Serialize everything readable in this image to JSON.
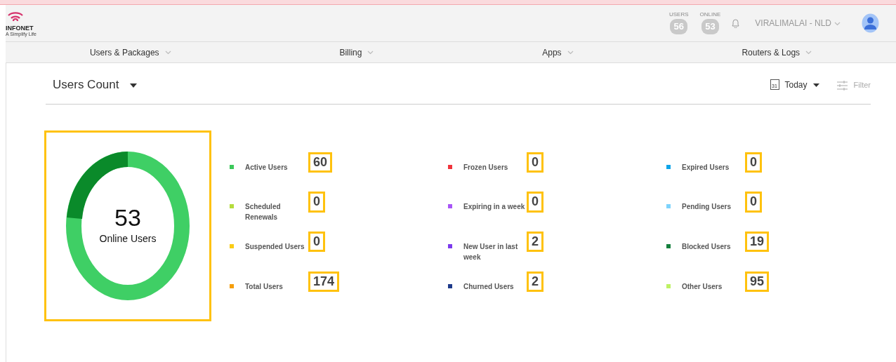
{
  "header": {
    "logo_text": "INFONET",
    "tagline": "A Simplify Life",
    "counters": [
      {
        "label": "USERS",
        "value": "56"
      },
      {
        "label": "ONLINE",
        "value": "53"
      }
    ],
    "location": "VIRALIMALAI - NLD"
  },
  "nav": [
    "Users & Packages",
    "Billing",
    "Apps",
    "Routers & Logs"
  ],
  "toolbar": {
    "title": "Users Count",
    "date_icon_day": "31",
    "date_range": "Today",
    "filter": "Filter"
  },
  "summary": {
    "count": "53",
    "label": "Online Users"
  },
  "stats": [
    {
      "label": "Active Users",
      "value": "60",
      "color": "#3cc85a"
    },
    {
      "label": "Frozen Users",
      "value": "0",
      "color": "#f0343c"
    },
    {
      "label": "Expired Users",
      "value": "0",
      "color": "#0ea5e9"
    },
    {
      "label": "Scheduled Renewals",
      "value": "0",
      "color": "#b5dc3c"
    },
    {
      "label": "Expiring in a week",
      "value": "0",
      "color": "#a855f7"
    },
    {
      "label": "Pending Users",
      "value": "0",
      "color": "#7dd3fc"
    },
    {
      "label": "Suspended Users",
      "value": "0",
      "color": "#facc15"
    },
    {
      "label": "New User in last week",
      "value": "2",
      "color": "#7c3aed"
    },
    {
      "label": "Blocked Users",
      "value": "19",
      "color": "#15803d"
    },
    {
      "label": "Total Users",
      "value": "174",
      "color": "#f59e0b"
    },
    {
      "label": "Churned Users",
      "value": "2",
      "color": "#1e3a8a"
    },
    {
      "label": "Other Users",
      "value": "95",
      "color": "#bef264"
    }
  ]
}
